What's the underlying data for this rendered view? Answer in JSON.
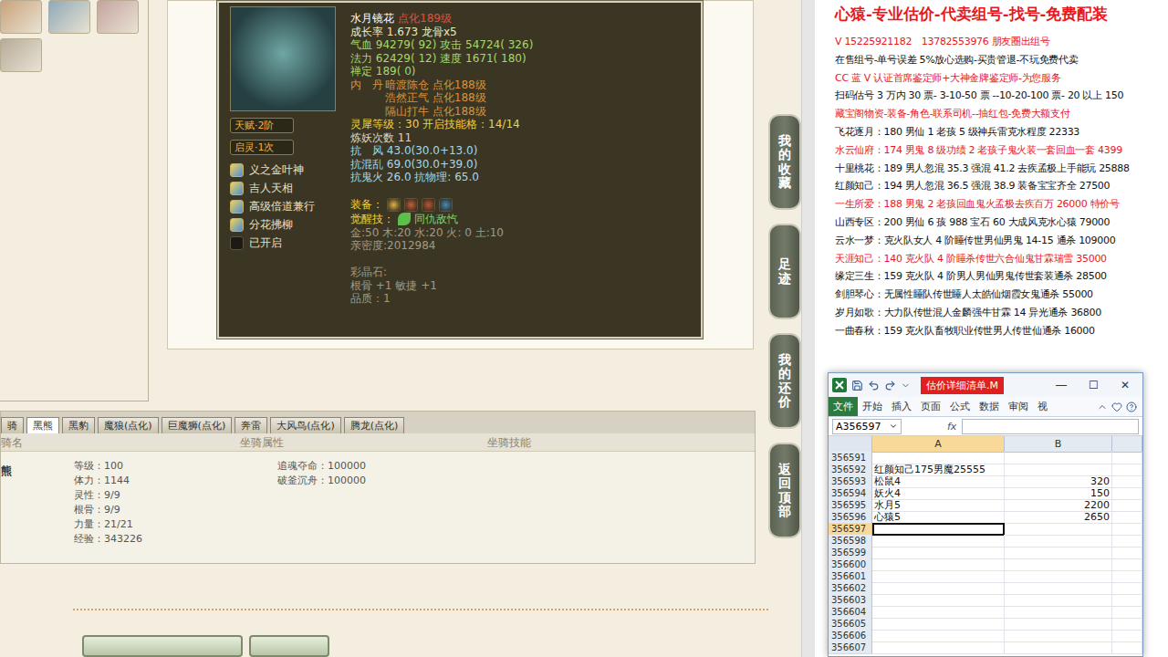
{
  "pet_card": {
    "name": "水月镜花",
    "tag": "点化189级",
    "badges": [
      "天赋·2阶",
      "启灵·1次"
    ],
    "skills": [
      {
        "name": "义之金叶神",
        "kind": "skill"
      },
      {
        "name": "吉人天相",
        "kind": "skill"
      },
      {
        "name": "高级倍道兼行",
        "kind": "skill"
      },
      {
        "name": "分花拂柳",
        "kind": "skill"
      },
      {
        "name": "已开启",
        "kind": "slot"
      }
    ],
    "lines": [
      {
        "kind": "growth",
        "text": "成长率 1.673 龙骨x5"
      },
      {
        "kind": "stat",
        "text": "气血 94279( 92) 攻击 54724( 326)"
      },
      {
        "kind": "stat",
        "text": "法力 62429( 12) 速度 1671( 180)"
      },
      {
        "kind": "stat",
        "text": "禅定 189( 0)"
      },
      {
        "kind": "dan",
        "label": "内　丹",
        "text": "暗渡陈仓 点化188级"
      },
      {
        "kind": "dan",
        "label": "",
        "text": "浩然正气 点化188级"
      },
      {
        "kind": "dan",
        "label": "",
        "text": "隔山打牛 点化188级"
      },
      {
        "kind": "level",
        "text": "灵犀等级：30 开启技能格：14/14"
      },
      {
        "kind": "plain",
        "text": "炼妖次数 11"
      },
      {
        "kind": "resist",
        "text": "抗　风 43.0(30.0+13.0)"
      },
      {
        "kind": "resist",
        "text": "抗混乱 69.0(30.0+39.0)"
      },
      {
        "kind": "resist",
        "text": "抗鬼火 26.0 抗物理: 65.0"
      },
      {
        "kind": "gap"
      },
      {
        "kind": "gear",
        "label": "装备："
      },
      {
        "kind": "awake",
        "label": "觉醒技：",
        "text": "同仇敌忾"
      },
      {
        "kind": "muted",
        "text": "金:50 木:20 水:20 火: 0 土:10"
      },
      {
        "kind": "muted",
        "text": "亲密度:2012984"
      },
      {
        "kind": "gap"
      },
      {
        "kind": "muted",
        "text": "彩晶石:"
      },
      {
        "kind": "muted",
        "text": "根骨 +1 敏捷 +1"
      },
      {
        "kind": "muted",
        "text": "品质：1"
      }
    ]
  },
  "side_buttons": [
    "我的收藏",
    "足迹",
    "我的还价",
    "返回顶部"
  ],
  "mount": {
    "tabs": [
      {
        "label": "骑",
        "selected": false
      },
      {
        "label": "黑熊",
        "selected": true
      },
      {
        "label": "黑豹",
        "selected": false
      },
      {
        "label": "魔狼(点化)",
        "selected": false
      },
      {
        "label": "巨魔狮(点化)",
        "selected": false
      },
      {
        "label": "奔雷",
        "selected": false
      },
      {
        "label": "大风鸟(点化)",
        "selected": false
      },
      {
        "label": "腾龙(点化)",
        "selected": false
      }
    ],
    "columns": [
      "骑名",
      "坐骑属性",
      "坐骑技能"
    ],
    "row": {
      "name": "熊",
      "attributes": [
        "等级：100",
        "体力：1144",
        "灵性：9/9",
        "根骨：9/9",
        "力量：21/21",
        "经验：343226"
      ],
      "skills": [
        "追魂夺命：100000",
        "破釜沉舟：100000"
      ]
    }
  },
  "ad_panel": {
    "title": "心猿-专业估价-代卖组号-找号-免费配装",
    "lines": [
      {
        "text": "V 15225921182　13782553976 朋友圈出组号",
        "color": "#e8181c"
      },
      {
        "text": "在售组号-单号误差 5%放心选购-买贵管退-不玩免费代卖",
        "color": "#111111"
      },
      {
        "text": "CC 蓝 V 认证首席鉴定师+大神金牌鉴定师-为您服务",
        "color": "#e8181c"
      },
      {
        "text": "扫码估号 3 万内 30 票- 3-10-50 票 --10-20-100 票- 20 以上 150",
        "color": "#111111"
      },
      {
        "text": "藏宝阁物资-装备-角色-联系司机--抽红包-免费大额支付",
        "color": "#e8181c"
      },
      {
        "text": "飞花逐月：180 男仙 1 老孩 5 级神兵雷克水程度 22333",
        "color": "#111111"
      },
      {
        "text": "水云仙府：174 男鬼 8 级功绩 2 老孩子鬼火装一套回血一套 4399",
        "color": "#e8181c"
      },
      {
        "text": "十里桃花：189 男人忽混 35.3 强混 41.2 去疾孟极上手能玩 25888",
        "color": "#111111"
      },
      {
        "text": "红颜知己：194 男人忽混 36.5 强混 38.9 装备宝宝齐全 27500",
        "color": "#111111"
      },
      {
        "text": "一生所爱：188 男鬼 2 老孩回血鬼火孟极去疾百万 26000 特价号",
        "color": "#e8181c"
      },
      {
        "text": "山西专区：200 男仙 6 孩 988 宝石 60 大成风克水心猿 79000",
        "color": "#111111"
      },
      {
        "text": "云水一梦：克火队女人 4 阶睡传世男仙男鬼 14-15 通杀 109000",
        "color": "#111111"
      },
      {
        "text": "天涯知己：140 克火队 4 阶睡杀传世六合仙鬼甘霖瑞雪 35000",
        "color": "#e8181c"
      },
      {
        "text": "缘定三生：159 克火队 4 阶男人男仙男鬼传世套装通杀 28500",
        "color": "#111111"
      },
      {
        "text": "剑胆琴心：无属性睡队传世睡人太皓仙烟霞女鬼通杀 55000",
        "color": "#111111"
      },
      {
        "text": "岁月如歌：大力队传世混人金麟强牛甘霖 14 异光通杀 36800",
        "color": "#111111"
      },
      {
        "text": "一曲春秋：159 克火队畜牧职业传世男人传世仙通杀 16000",
        "color": "#111111"
      }
    ]
  },
  "excel": {
    "title": "估价详细清单.M",
    "controls": [
      "—",
      "☐",
      "✕"
    ],
    "menu": [
      {
        "label": "文件",
        "selected": true
      },
      {
        "label": "开始",
        "selected": false
      },
      {
        "label": "插入",
        "selected": false
      },
      {
        "label": "页面",
        "selected": false
      },
      {
        "label": "公式",
        "selected": false
      },
      {
        "label": "数据",
        "selected": false
      },
      {
        "label": "审阅",
        "selected": false
      },
      {
        "label": "视",
        "selected": false
      }
    ],
    "name_box": "A356597",
    "fx": "fx",
    "columns": [
      {
        "label": "A",
        "selected": true
      },
      {
        "label": "B",
        "selected": false
      }
    ],
    "rows": [
      {
        "num": "356591",
        "a": "",
        "b": "",
        "selected": false
      },
      {
        "num": "356592",
        "a": "红颜知己175男魔25555",
        "b": "",
        "selected": false
      },
      {
        "num": "356593",
        "a": "松鼠4",
        "b": "320",
        "selected": false
      },
      {
        "num": "356594",
        "a": "妖火4",
        "b": "150",
        "selected": false
      },
      {
        "num": "356595",
        "a": "水月5",
        "b": "2200",
        "selected": false
      },
      {
        "num": "356596",
        "a": "心猿5",
        "b": "2650",
        "selected": false
      },
      {
        "num": "356597",
        "a": "",
        "b": "",
        "selected": true
      },
      {
        "num": "356598",
        "a": "",
        "b": "",
        "selected": false
      },
      {
        "num": "356599",
        "a": "",
        "b": "",
        "selected": false
      },
      {
        "num": "356600",
        "a": "",
        "b": "",
        "selected": false
      },
      {
        "num": "356601",
        "a": "",
        "b": "",
        "selected": false
      },
      {
        "num": "356602",
        "a": "",
        "b": "",
        "selected": false
      },
      {
        "num": "356603",
        "a": "",
        "b": "",
        "selected": false
      },
      {
        "num": "356604",
        "a": "",
        "b": "",
        "selected": false
      },
      {
        "num": "356605",
        "a": "",
        "b": "",
        "selected": false
      },
      {
        "num": "356606",
        "a": "",
        "b": "",
        "selected": false
      },
      {
        "num": "356607",
        "a": "",
        "b": "",
        "selected": false
      }
    ]
  }
}
